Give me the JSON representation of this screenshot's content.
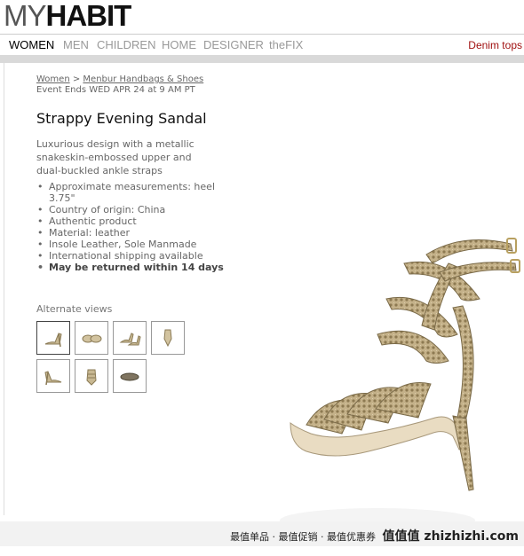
{
  "brand": {
    "part1": "MY",
    "part2": "HABIT"
  },
  "nav": {
    "items": [
      {
        "label": "WOMEN",
        "active": true
      },
      {
        "label": "MEN"
      },
      {
        "label": "CHILDREN"
      },
      {
        "label": "HOME"
      },
      {
        "label": "DESIGNER"
      },
      {
        "label": "theFIX"
      }
    ],
    "promo": "Denim tops"
  },
  "breadcrumb": {
    "root": "Women",
    "separator": ">",
    "sale": "Menbur Handbags & Shoes"
  },
  "event": "Event Ends WED APR 24 at 9 AM PT",
  "product": {
    "title": "Strappy Evening Sandal",
    "description": "Luxurious design with a metallic snakeskin-embossed upper and dual-buckled ankle straps",
    "features": [
      "Approximate measurements: heel 3.75\"",
      "Country of origin: China",
      "Authentic product",
      "Material: leather",
      "Insole Leather, Sole Manmade",
      "International shipping available"
    ],
    "return_policy": "May be returned within 14 days"
  },
  "alternate_views": {
    "label": "Alternate views",
    "count": 7
  },
  "colors": {
    "promo": "#a01010",
    "snakeskin": "#b9a77c",
    "band": "#d9d9d9"
  },
  "footer": {
    "slogan": "最值单品 · 最值促销 · 最值优惠券",
    "brand": "值值值 zhizhizhi.com"
  }
}
